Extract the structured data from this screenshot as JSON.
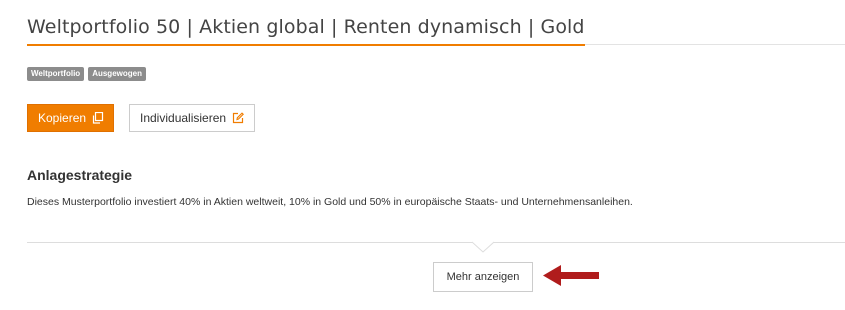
{
  "page": {
    "title": "Weltportfolio 50 | Aktien global | Renten dynamisch | Gold"
  },
  "tags": [
    "Weltportfolio",
    "Ausgewogen"
  ],
  "actions": {
    "copy_label": "Kopieren",
    "copy_icon": "copy-icon",
    "customize_label": "Individualisieren",
    "customize_icon": "edit-icon"
  },
  "strategy": {
    "heading": "Anlagestrategie",
    "text": "Dieses Musterportfolio investiert 40% in Aktien weltweit, 10% in Gold und 50% in europäische Staats- und Unternehmensanleihen."
  },
  "more": {
    "label": "Mehr anzeigen"
  },
  "colors": {
    "accent": "#f07d00",
    "tag_bg": "#8c8c8c",
    "annotation_arrow": "#b01c1c"
  }
}
